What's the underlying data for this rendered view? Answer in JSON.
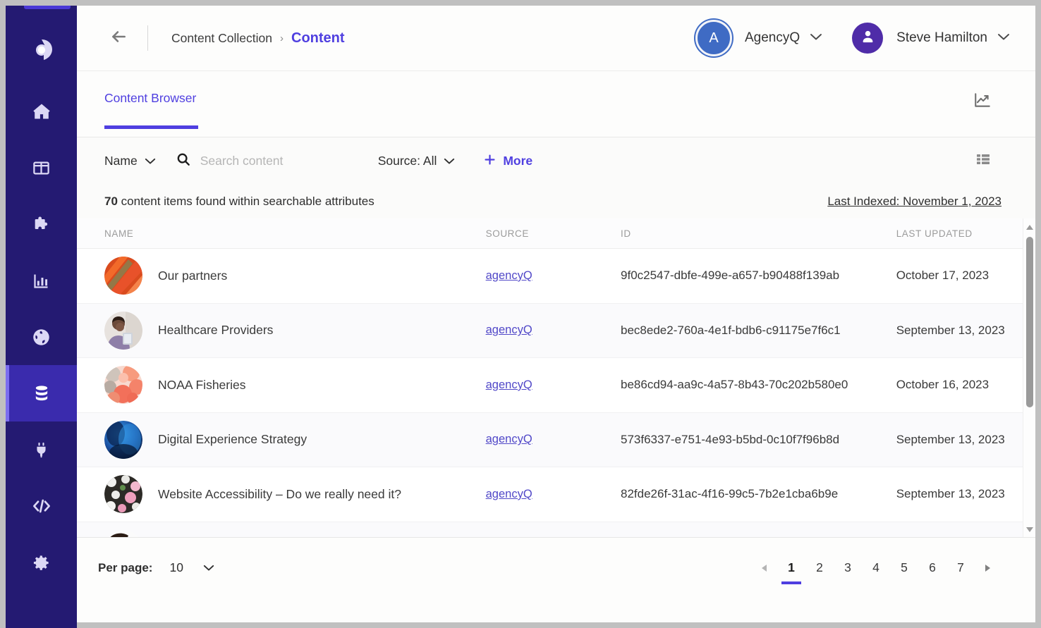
{
  "window": {
    "bg": "#c0c0c0"
  },
  "sidebar": {
    "accent_color": "#7b6ef0",
    "bg_color": "#241a72",
    "active_bg": "#3a2bad",
    "logo": "app-logo-icon",
    "items": [
      {
        "name": "home",
        "icon": "home-icon",
        "active": false
      },
      {
        "name": "pages",
        "icon": "layout-columns-icon",
        "active": false
      },
      {
        "name": "components",
        "icon": "puzzle-piece-icon",
        "active": false
      },
      {
        "name": "analytics",
        "icon": "bar-chart-icon",
        "active": false
      },
      {
        "name": "sites",
        "icon": "globe-icon",
        "active": false
      },
      {
        "name": "content",
        "icon": "database-icon",
        "active": true
      },
      {
        "name": "integrations",
        "icon": "plug-icon",
        "active": false
      },
      {
        "name": "developer",
        "icon": "code-icon",
        "active": false
      },
      {
        "name": "settings",
        "icon": "gear-icon",
        "active": false
      }
    ]
  },
  "header": {
    "back_icon": "arrow-left-icon",
    "breadcrumb": {
      "parent": "Content Collection",
      "separator": "›",
      "current": "Content"
    },
    "org": {
      "initial": "A",
      "name": "AgencyQ",
      "caret": "⌄"
    },
    "user": {
      "icon": "user-icon",
      "name": "Steve Hamilton",
      "caret": "⌄"
    }
  },
  "tabs": {
    "items": [
      {
        "label": "Content Browser",
        "active": true
      }
    ],
    "right_icon": "trend-chart-icon"
  },
  "toolbar": {
    "sort": {
      "label": "Name",
      "caret": "⌄"
    },
    "search": {
      "icon": "search-icon",
      "value": "",
      "placeholder": "Search content"
    },
    "source_filter": {
      "label": "Source: All",
      "caret": "⌄"
    },
    "more": {
      "icon": "plus-icon",
      "label": "More"
    },
    "view_toggle_icon": "list-view-icon"
  },
  "results": {
    "count": "70",
    "count_text": "content items found within searchable attributes",
    "last_indexed": "Last Indexed: November 1, 2023"
  },
  "table": {
    "columns": [
      "NAME",
      "SOURCE",
      "ID",
      "LAST UPDATED"
    ],
    "rows": [
      {
        "name": "Our partners",
        "source": "agencyQ",
        "id": "9f0c2547-dbfe-499e-a657-b90488f139ab",
        "updated": "October 17, 2023",
        "thumb": "abstract-orange-stripes"
      },
      {
        "name": "Healthcare Providers",
        "source": "agencyQ",
        "id": "bec8ede2-760a-4e1f-bdb6-c91175e7f6c1",
        "updated": "September 13, 2023",
        "thumb": "nurse-photo"
      },
      {
        "name": "NOAA Fisheries",
        "source": "agencyQ",
        "id": "be86cd94-aa9c-4a57-8b43-70c202b580e0",
        "updated": "October 16, 2023",
        "thumb": "coral-reef-photo"
      },
      {
        "name": "Digital Experience Strategy",
        "source": "agencyQ",
        "id": "573f6337-e751-4e93-b5bd-0c10f7f96b8d",
        "updated": "September 13, 2023",
        "thumb": "blue-abstract"
      },
      {
        "name": "Website Accessibility – Do we really need it?",
        "source": "agencyQ",
        "id": "82fde26f-31ac-4f16-99c5-7b2e1cba6b9e",
        "updated": "September 13, 2023",
        "thumb": "flowers-photo"
      }
    ],
    "scrollbar": {
      "up_icon": "caret-up-icon",
      "down_icon": "caret-down-icon"
    }
  },
  "footer": {
    "per_page_label": "Per page:",
    "per_page_value": "10",
    "per_page_caret": "⌄",
    "prev_icon": "caret-left-icon",
    "next_icon": "caret-right-icon",
    "pages": [
      "1",
      "2",
      "3",
      "4",
      "5",
      "6",
      "7"
    ],
    "active_page": "1"
  },
  "colors": {
    "accent": "#4f3fe0",
    "link": "#5148c8",
    "sidebar": "#241a72"
  }
}
